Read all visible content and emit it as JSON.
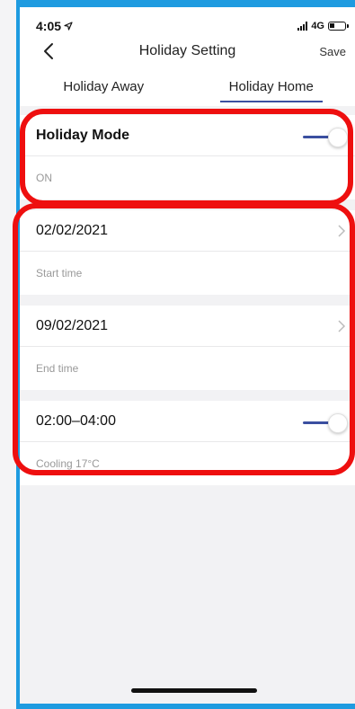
{
  "status_bar": {
    "time": "4:05",
    "network": "4G"
  },
  "header": {
    "title": "Holiday Setting",
    "save_label": "Save"
  },
  "tabs": [
    {
      "label": "Holiday Away",
      "active": false
    },
    {
      "label": "Holiday Home",
      "active": true
    }
  ],
  "holiday_mode": {
    "label": "Holiday Mode",
    "status": "ON",
    "enabled": true
  },
  "schedule": {
    "start_date": "02/02/2021",
    "start_caption": "Start time",
    "end_date": "09/02/2021",
    "end_caption": "End time",
    "time_range": "02:00–04:00",
    "time_range_caption": "Cooling 17°C",
    "time_range_enabled": true
  },
  "colors": {
    "accent": "#3b4fa0",
    "highlight": "#ee0f0f",
    "frame": "#1e9be0"
  },
  "icons": [
    "back-chevron-icon",
    "location-arrow-icon",
    "signal-icon",
    "battery-icon",
    "chevron-right-icon"
  ]
}
